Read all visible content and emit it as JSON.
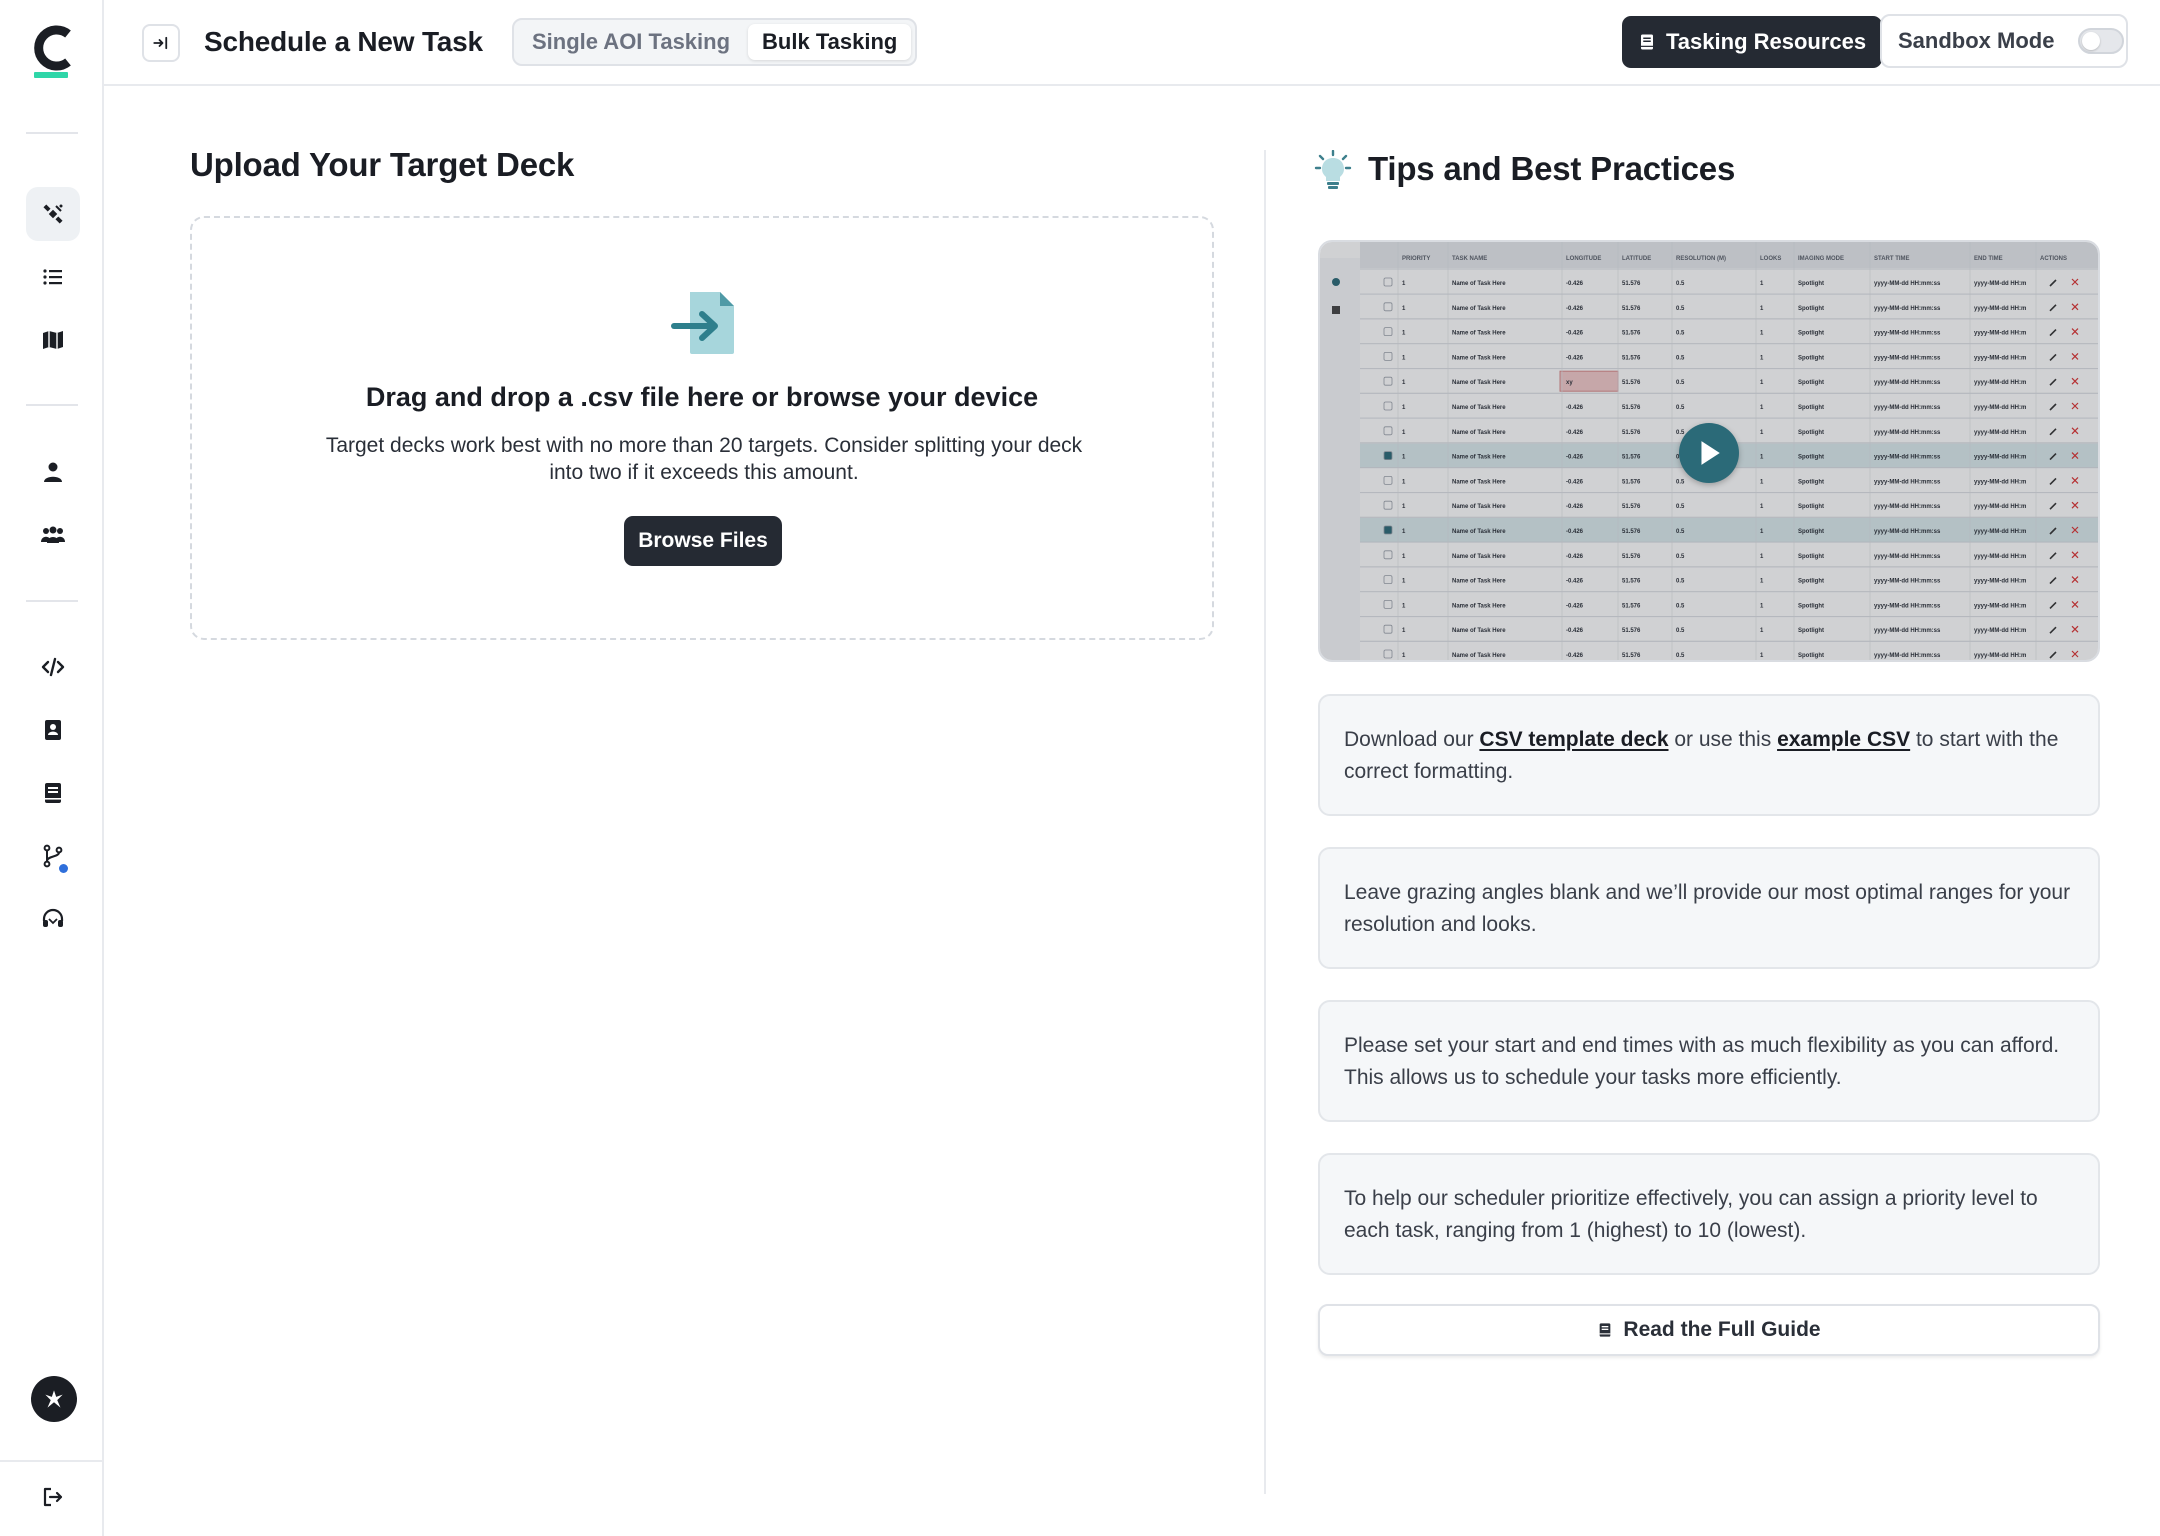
{
  "sidebar": {
    "logo_letter": "C",
    "icons": [
      {
        "name": "satellite-icon",
        "active": true
      },
      {
        "name": "list-icon",
        "active": false
      },
      {
        "name": "map-icon",
        "active": false
      },
      {
        "name": "user-icon",
        "active": false
      },
      {
        "name": "users-group-icon",
        "active": false
      },
      {
        "name": "code-icon",
        "active": false
      },
      {
        "name": "book-account-icon",
        "active": false
      },
      {
        "name": "book-icon",
        "active": false
      },
      {
        "name": "git-branch-icon",
        "active": false
      },
      {
        "name": "headset-icon",
        "active": false
      }
    ],
    "accent_color": "#2fd6a8",
    "notification_color": "#2f6fdb",
    "logout_icon": "logout-icon"
  },
  "header": {
    "title": "Schedule a New Task",
    "tabs": [
      {
        "label": "Single AOI Tasking",
        "active": false
      },
      {
        "label": "Bulk Tasking",
        "active": true
      }
    ],
    "resources_button": "Tasking Resources",
    "sandbox_label": "Sandbox Mode",
    "sandbox_on": false
  },
  "upload": {
    "title": "Upload Your Target Deck",
    "drop_heading": "Drag and drop a .csv file here or browse your device",
    "drop_description": "Target decks work best with no more than 20 targets. Consider splitting your deck into two if it exceeds this amount.",
    "browse_button": "Browse Files"
  },
  "tips": {
    "title": "Tips and Best Practices",
    "video": {
      "columns": [
        "PRIORITY",
        "TASK NAME",
        "LONGITUDE",
        "LATITUDE",
        "RESOLUTION (M)",
        "LOOKS",
        "IMAGING MODE",
        "START TIME",
        "END TIME",
        "ACTIONS"
      ],
      "row": [
        "1",
        "Name of Task Here",
        "-0.426",
        "51.576",
        "0.5",
        "1",
        "Spotlight",
        "yyyy-MM-dd HH:mm:ss",
        "yyyy-MM-dd HH:m"
      ]
    },
    "tip1": {
      "pre": "Download our ",
      "link1": "CSV template deck",
      "mid": " or use this ",
      "link2": "example CSV",
      "post": " to start with the correct formatting."
    },
    "tip2": "Leave grazing angles blank and we’ll provide our most optimal ranges for your resolution and looks.",
    "tip3": "Please set your start and end times with as much flexibility as you can afford. This allows us to schedule your tasks more efficiently.",
    "tip4": "To help our scheduler prioritize effectively, you can assign a priority level to each task, ranging from 1 (highest) to 10 (lowest).",
    "guide_button": "Read the Full Guide"
  }
}
